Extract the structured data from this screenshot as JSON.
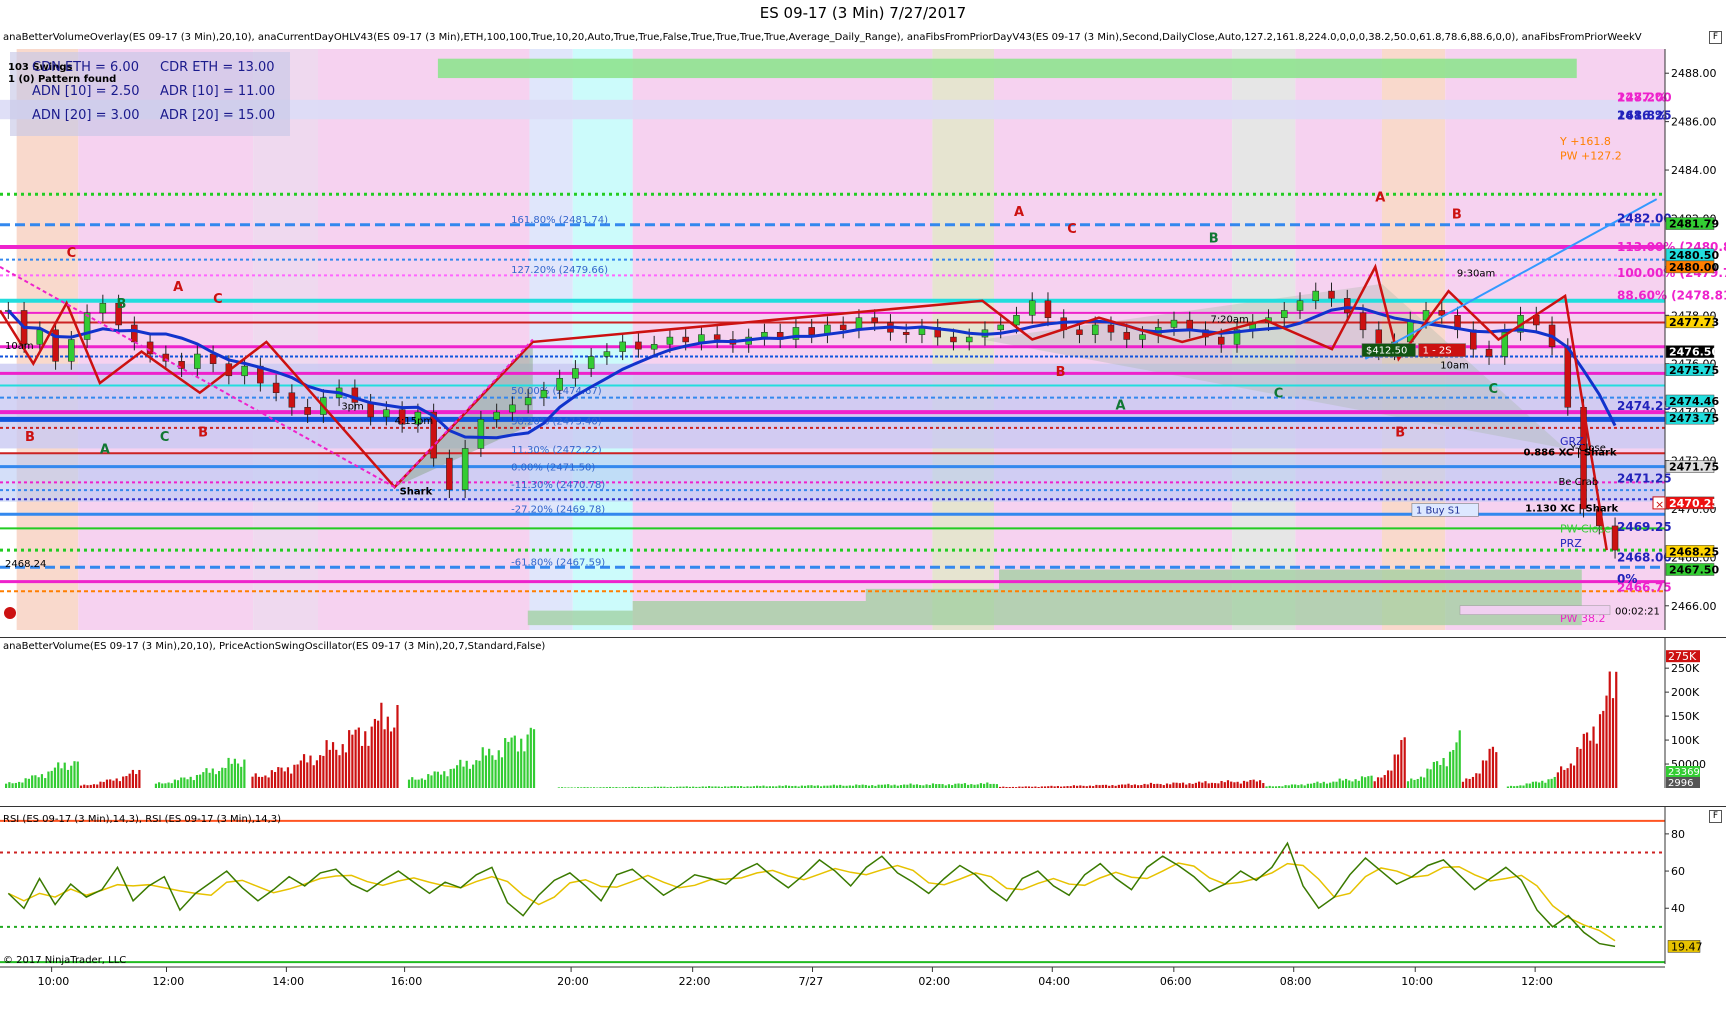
{
  "window": {
    "title": "ES 09-17 (3 Min)  7/27/2017"
  },
  "panels": {
    "price_label": "anaBetterVolumeOverlay(ES 09-17 (3 Min),20,10), anaCurrentDayOHLV43(ES 09-17 (3 Min),ETH,100,100,True,10,20,Auto,True,True,False,True,True,True,True,Average_Daily_Range), anaFibsFromPriorDayV43(ES 09-17 (3 Min),Second,DailyClose,Auto,127.2,161.8,224.0,0,0,0,38.2,50.0,61.8,78.6,88.6,0,0), anaFibsFromPriorWeekV",
    "volume_label": "anaBetterVolume(ES 09-17 (3 Min),20,10), PriceActionSwingOscillator(ES 09-17 (3 Min),20,7,Standard,False)",
    "rsi_label": "RSI (ES 09-17 (3 Min),14,3), RSI (ES 09-17 (3 Min),14,3)",
    "copyright": "© 2017 NinjaTrader, LLC",
    "panel_button": "F",
    "close_button": "×"
  },
  "stats": {
    "swings": "103 Swings",
    "pattern": "1 (0) Pattern found",
    "cdn_eth": "CDN ETH = 6.00",
    "cdr_eth": "CDR ETH = 13.00",
    "adn10": "ADN [10] = 2.50",
    "adr10": "ADR [10] = 11.00",
    "adn20": "ADN [20] = 3.00",
    "adr20": "ADR [20] = 15.00"
  },
  "timer": "00:02:21",
  "colors": {
    "bull": "#33cc33",
    "bear": "#cc1111",
    "blue": "#1155dd",
    "magenta": "#ee22cc",
    "green_dot": "#22cc22",
    "cyan": "#22dddd",
    "fib_blue": "#3388ee",
    "orange": "#ff7f00",
    "rsi_line": "#3a7a00",
    "rsi_signal": "#e6c200"
  },
  "chart_data": [
    {
      "type": "candlestick",
      "name": "price",
      "y_ticks": [
        2466.0,
        2468.0,
        2470.0,
        2472.0,
        2474.0,
        2476.0,
        2478.0,
        2480.0,
        2482.0,
        2484.0,
        2486.0,
        2488.0
      ],
      "y_tick_labels": [
        "2466.00",
        "2468.00",
        "2470.00",
        "2472.00",
        "2474.00",
        "2476.00",
        "2478.00",
        "2480.00",
        "2482.00",
        "2484.00",
        "2486.00",
        "2488.00"
      ],
      "ylim": [
        2465.0,
        2489.0
      ],
      "x_ticks": [
        "10:00",
        "12:00",
        "14:00",
        "16:00",
        "20:00",
        "22:00",
        "7/27",
        "02:00",
        "04:00",
        "06:00",
        "08:00",
        "10:00",
        "12:00"
      ],
      "fib_levels": [
        {
          "label": "161.80% (2481.74)",
          "value": 2481.74
        },
        {
          "label": "127.20% (2479.66)",
          "value": 2479.66
        },
        {
          "label": "50.00% (2474.67)",
          "value": 2474.67
        },
        {
          "label": "38.20% (2473.40)",
          "value": 2473.4
        },
        {
          "label": "11.30% (2472.22)",
          "value": 2472.22
        },
        {
          "label": "0.00% (2471.50)",
          "value": 2471.5
        },
        {
          "label": "-11.30% (2470.78)",
          "value": 2470.78
        },
        {
          "label": "-27.20% (2469.78)",
          "value": 2469.78
        },
        {
          "label": "-61.80% (2467.59)",
          "value": 2467.59
        }
      ],
      "right_labels": [
        {
          "text": "127.2%",
          "value": 2487.0,
          "color": "#ee22cc"
        },
        {
          "text": "2487.00",
          "value": 2487.0,
          "color": "#ee22cc"
        },
        {
          "text": "161.8%",
          "value": 2486.25,
          "color": "#2222bb"
        },
        {
          "text": "2486.25",
          "value": 2486.25,
          "color": "#2222bb"
        },
        {
          "text": "Y +161.8",
          "value": 2485.2,
          "color": "#ff7f00"
        },
        {
          "text": "PW +127.2",
          "value": 2484.6,
          "color": "#ff7f00"
        },
        {
          "text": "2482.00",
          "value": 2482.0,
          "color": "#2222bb"
        },
        {
          "text": "113.00% (2480.82)",
          "value": 2480.82,
          "color": "#ee22cc"
        },
        {
          "text": "100.00% (2479.75)",
          "value": 2479.75,
          "color": "#ee22cc"
        },
        {
          "text": "88.60% (2478.81)",
          "value": 2478.81,
          "color": "#ee22cc"
        },
        {
          "text": "2474.25",
          "value": 2474.25,
          "color": "#2222bb"
        },
        {
          "text": "GRZ",
          "value": 2472.8,
          "color": "#2222bb"
        },
        {
          "text": "2471.25",
          "value": 2471.25,
          "color": "#2222bb"
        },
        {
          "text": "PW-Close",
          "value": 2469.2,
          "color": "#33cc33"
        },
        {
          "text": "2469.25",
          "value": 2469.25,
          "color": "#2222bb"
        },
        {
          "text": "PRZ",
          "value": 2468.6,
          "color": "#2222bb"
        },
        {
          "text": "2468.00",
          "value": 2468.0,
          "color": "#2222bb"
        },
        {
          "text": "0%",
          "value": 2467.1,
          "color": "#2222bb"
        },
        {
          "text": "2466.75",
          "value": 2466.75,
          "color": "#ee22cc"
        },
        {
          "text": "PW 38.2",
          "value": 2465.5,
          "color": "#ee22cc"
        }
      ],
      "axis_tags": [
        {
          "text": "2481.79",
          "value": 2481.79,
          "bg": "#33cc33"
        },
        {
          "text": "2480.50",
          "value": 2480.5,
          "bg": "#22dddd"
        },
        {
          "text": "2480.00",
          "value": 2480.0,
          "bg": "#ff7f00"
        },
        {
          "text": "2477.73",
          "value": 2477.73,
          "bg": "#ffd400"
        },
        {
          "text": "2476.50",
          "value": 2476.5,
          "bg": "#000000"
        },
        {
          "text": "2475.75",
          "value": 2475.75,
          "bg": "#22dddd"
        },
        {
          "text": "2474.46",
          "value": 2474.46,
          "bg": "#22dddd"
        },
        {
          "text": "2473.75",
          "value": 2473.75,
          "bg": "#22dddd"
        },
        {
          "text": "2471.75",
          "value": 2471.75,
          "bg": "#dddddd"
        },
        {
          "text": "2470.25",
          "value": 2470.25,
          "bg": "#ee1111"
        },
        {
          "text": "2468.25",
          "value": 2468.25,
          "bg": "#ffd400"
        },
        {
          "text": "2467.50",
          "value": 2467.5,
          "bg": "#33cc33"
        }
      ],
      "chart_text": [
        {
          "text": "9:30am",
          "x": 0.875,
          "y": 2479.6
        },
        {
          "text": "10am",
          "x": 0.865,
          "y": 2475.8
        },
        {
          "text": "7:20am",
          "x": 0.727,
          "y": 2477.7
        },
        {
          "text": "3pm",
          "x": 0.205,
          "y": 2474.1
        },
        {
          "text": "4:15pm",
          "x": 0.237,
          "y": 2473.5
        },
        {
          "text": "10am",
          "x": 0.003,
          "y": 2476.6
        },
        {
          "text": "Shark",
          "x": 0.24,
          "y": 2470.6
        },
        {
          "text": "0.886 XC | Shark",
          "x": 0.915,
          "y": 2472.2
        },
        {
          "text": "1.130 XC | Shark",
          "x": 0.916,
          "y": 2469.9
        },
        {
          "text": "Be Crab",
          "x": 0.936,
          "y": 2471.0
        },
        {
          "text": "Y-Close",
          "x": 0.943,
          "y": 2472.4
        },
        {
          "text": "2468.24",
          "x": 0.003,
          "y": 2467.6
        }
      ],
      "box_labels": [
        {
          "text": "$412.50",
          "x": 0.818,
          "y": 2476.5,
          "bg": "#115511"
        },
        {
          "text": "1 - 2S",
          "x": 0.852,
          "y": 2476.5,
          "bg": "#cc1111"
        },
        {
          "text": "1  Buy S1",
          "x": 0.848,
          "y": 2469.9,
          "bg": "#dde8ff"
        }
      ],
      "swing_letters": [
        {
          "t": "C",
          "x": 0.04,
          "y": 2480.4,
          "color": "#cc1111"
        },
        {
          "t": "A",
          "x": 0.104,
          "y": 2479.0,
          "color": "#cc1111"
        },
        {
          "t": "C",
          "x": 0.128,
          "y": 2478.5,
          "color": "#cc1111"
        },
        {
          "t": "B",
          "x": 0.07,
          "y": 2478.3,
          "color": "#117733"
        },
        {
          "t": "B",
          "x": 0.015,
          "y": 2472.8,
          "color": "#cc1111"
        },
        {
          "t": "A",
          "x": 0.06,
          "y": 2472.3,
          "color": "#117733"
        },
        {
          "t": "C",
          "x": 0.096,
          "y": 2472.8,
          "color": "#117733"
        },
        {
          "t": "B",
          "x": 0.119,
          "y": 2473.0,
          "color": "#cc1111"
        },
        {
          "t": "A",
          "x": 0.609,
          "y": 2482.1,
          "color": "#cc1111"
        },
        {
          "t": "C",
          "x": 0.641,
          "y": 2481.4,
          "color": "#cc1111"
        },
        {
          "t": "B",
          "x": 0.726,
          "y": 2481.0,
          "color": "#117733"
        },
        {
          "t": "A",
          "x": 0.826,
          "y": 2482.7,
          "color": "#cc1111"
        },
        {
          "t": "B",
          "x": 0.872,
          "y": 2482.0,
          "color": "#cc1111"
        },
        {
          "t": "C",
          "x": 0.894,
          "y": 2474.8,
          "color": "#117733"
        },
        {
          "t": "A",
          "x": 0.67,
          "y": 2474.1,
          "color": "#117733"
        },
        {
          "t": "C",
          "x": 0.765,
          "y": 2474.6,
          "color": "#117733"
        },
        {
          "t": "B",
          "x": 0.634,
          "y": 2475.5,
          "color": "#cc1111"
        },
        {
          "t": "B",
          "x": 0.838,
          "y": 2473.0,
          "color": "#cc1111"
        }
      ],
      "ohlc": [
        2478.2,
        2476.8,
        2477.4,
        2476.1,
        2477.0,
        2478.1,
        2478.5,
        2477.6,
        2476.9,
        2476.4,
        2476.1,
        2475.8,
        2476.4,
        2476.0,
        2475.5,
        2475.9,
        2475.2,
        2474.8,
        2474.2,
        2473.9,
        2474.6,
        2475.0,
        2474.4,
        2473.8,
        2474.1,
        2473.5,
        2474.0,
        2472.1,
        2470.8,
        2472.5,
        2473.7,
        2474.0,
        2474.3,
        2474.6,
        2474.9,
        2475.4,
        2475.8,
        2476.3,
        2476.5,
        2476.9,
        2476.6,
        2476.8,
        2477.1,
        2476.9,
        2477.2,
        2477.0,
        2476.8,
        2477.1,
        2477.3,
        2477.0,
        2477.5,
        2477.2,
        2477.6,
        2477.4,
        2477.9,
        2477.7,
        2477.3,
        2477.2,
        2477.5,
        2477.1,
        2476.9,
        2477.1,
        2477.4,
        2477.6,
        2478.0,
        2478.6,
        2477.9,
        2477.4,
        2477.2,
        2477.6,
        2477.3,
        2477.0,
        2477.2,
        2477.5,
        2477.8,
        2477.4,
        2477.1,
        2476.8,
        2477.4,
        2477.7,
        2477.9,
        2478.2,
        2478.6,
        2479.0,
        2478.7,
        2478.1,
        2477.4,
        2476.5,
        2476.9,
        2477.8,
        2478.2,
        2478.0,
        2477.4,
        2476.6,
        2476.3,
        2477.3,
        2478.0,
        2477.6,
        2476.7,
        2474.2,
        2470.0,
        2469.3,
        2468.3
      ]
    },
    {
      "type": "bar",
      "name": "volume",
      "y_ticks": [
        50000,
        100000,
        150000,
        200000,
        250000
      ],
      "y_tick_labels": [
        "50000",
        "100K",
        "150K",
        "200K",
        "250K"
      ],
      "ylim": [
        0,
        290000
      ],
      "last_tag": "275K",
      "tags": [
        {
          "text": "23369",
          "bg": "#33cc33"
        },
        {
          "text": "2996",
          "bg": "#555555"
        }
      ],
      "clusters": [
        {
          "start": 0.003,
          "end": 0.048,
          "peak": 80000,
          "color": "#33cc33"
        },
        {
          "start": 0.048,
          "end": 0.085,
          "peak": 45000,
          "color": "#cc1111"
        },
        {
          "start": 0.093,
          "end": 0.148,
          "peak": 80000,
          "color": "#33cc33"
        },
        {
          "start": 0.151,
          "end": 0.24,
          "peak": 210000,
          "color": "#cc1111"
        },
        {
          "start": 0.245,
          "end": 0.322,
          "peak": 155000,
          "color": "#33cc33"
        },
        {
          "start": 0.335,
          "end": 0.6,
          "peak": 12000,
          "color": "#33cc33"
        },
        {
          "start": 0.6,
          "end": 0.76,
          "peak": 20000,
          "color": "#cc1111"
        },
        {
          "start": 0.76,
          "end": 0.825,
          "peak": 30000,
          "color": "#33cc33"
        },
        {
          "start": 0.825,
          "end": 0.845,
          "peak": 125000,
          "color": "#cc1111"
        },
        {
          "start": 0.845,
          "end": 0.878,
          "peak": 125000,
          "color": "#33cc33"
        },
        {
          "start": 0.878,
          "end": 0.9,
          "peak": 115000,
          "color": "#cc1111"
        },
        {
          "start": 0.905,
          "end": 0.935,
          "peak": 28000,
          "color": "#33cc33"
        },
        {
          "start": 0.935,
          "end": 0.972,
          "peak": 290000,
          "color": "#cc1111"
        }
      ]
    },
    {
      "type": "line",
      "name": "rsi",
      "y_ticks": [
        40,
        60,
        80
      ],
      "y_tick_labels": [
        "40",
        "60",
        "80"
      ],
      "ylim": [
        10,
        95
      ],
      "levels": [
        {
          "value": 70,
          "color": "#cc2222"
        },
        {
          "value": 30,
          "color": "#22aa22"
        },
        {
          "value": 87,
          "color": "#ff5522"
        },
        {
          "value": 11,
          "color": "#22bb22"
        }
      ],
      "last_value": "19.47",
      "values": [
        48,
        40,
        56,
        42,
        53,
        46,
        50,
        62,
        44,
        52,
        57,
        39,
        48,
        54,
        60,
        51,
        44,
        50,
        57,
        52,
        59,
        61,
        53,
        49,
        55,
        60,
        54,
        48,
        54,
        51,
        58,
        62,
        43,
        36,
        47,
        55,
        59,
        52,
        44,
        58,
        61,
        54,
        47,
        52,
        58,
        56,
        53,
        60,
        64,
        57,
        51,
        58,
        66,
        60,
        52,
        62,
        68,
        59,
        54,
        48,
        56,
        63,
        58,
        50,
        44,
        56,
        60,
        52,
        47,
        58,
        64,
        56,
        50,
        62,
        68,
        63,
        57,
        49,
        53,
        60,
        55,
        62,
        75,
        52,
        40,
        46,
        58,
        67,
        60,
        53,
        57,
        63,
        66,
        58,
        50,
        56,
        62,
        55,
        39,
        30,
        36,
        27,
        21,
        19.47
      ]
    }
  ]
}
